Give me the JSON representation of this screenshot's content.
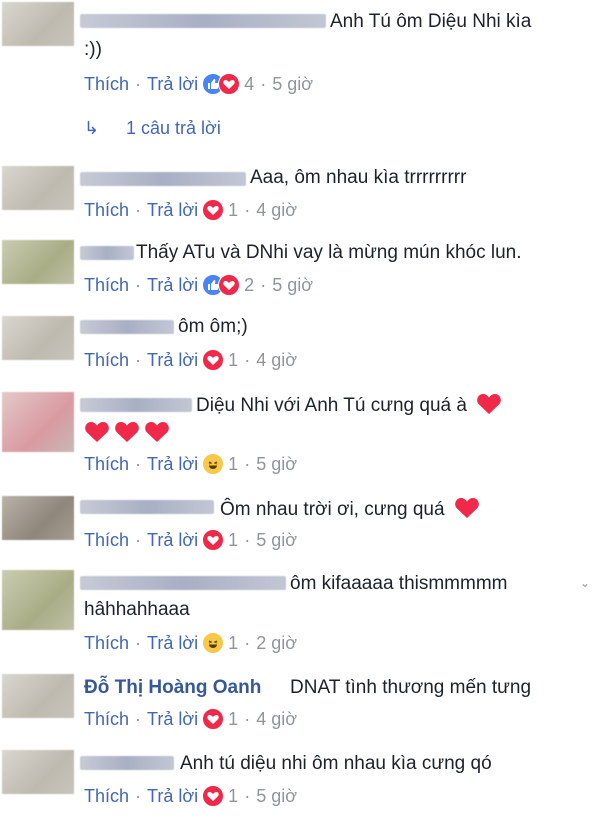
{
  "comments": [
    {
      "text": "Anh Tú ôm Diệu Nhi kìa",
      "text2": ":))",
      "reactions": "4",
      "time": "5 giờ"
    },
    {
      "text": "Aaa, ôm nhau kìa trrrrrrrrr",
      "reactions": "1",
      "time": "4 giờ"
    },
    {
      "text": "Thấy ATu và DNhi vay là mừng mún khóc lun.",
      "reactions": "2",
      "time": "5 giờ"
    },
    {
      "text": "ôm ôm;)",
      "reactions": "1",
      "time": "4 giờ"
    },
    {
      "text": "Diệu Nhi với Anh Tú cưng quá à",
      "reactions": "1",
      "time": "5 giờ"
    },
    {
      "text": "Ôm nhau trời ơi, cưng quá",
      "reactions": "1",
      "time": "5 giờ"
    },
    {
      "text": "ôm kifaaaaa thismmmmm",
      "text2": "hâhhahhaaa",
      "reactions": "1",
      "time": "2 giờ"
    },
    {
      "author": "Đỗ Thị Hoàng Oanh",
      "text": "DNAT tình thương mến tưng",
      "reactions": "1",
      "time": "4 giờ"
    },
    {
      "text": "Anh tú diệu nhi ôm nhau kìa cưng qó",
      "reactions": "1",
      "time": "5 giờ"
    }
  ],
  "labels": {
    "like": "Thích",
    "reply": "Trả lời",
    "separator": "·",
    "replies_count": "1 câu trả lời"
  },
  "colors": {
    "link": "#4267b2",
    "author": "#365899",
    "meta": "#90949c",
    "like_reaction": "#4a84f2",
    "love_reaction": "#f0284a",
    "haha_reaction": "#f7c94a"
  }
}
